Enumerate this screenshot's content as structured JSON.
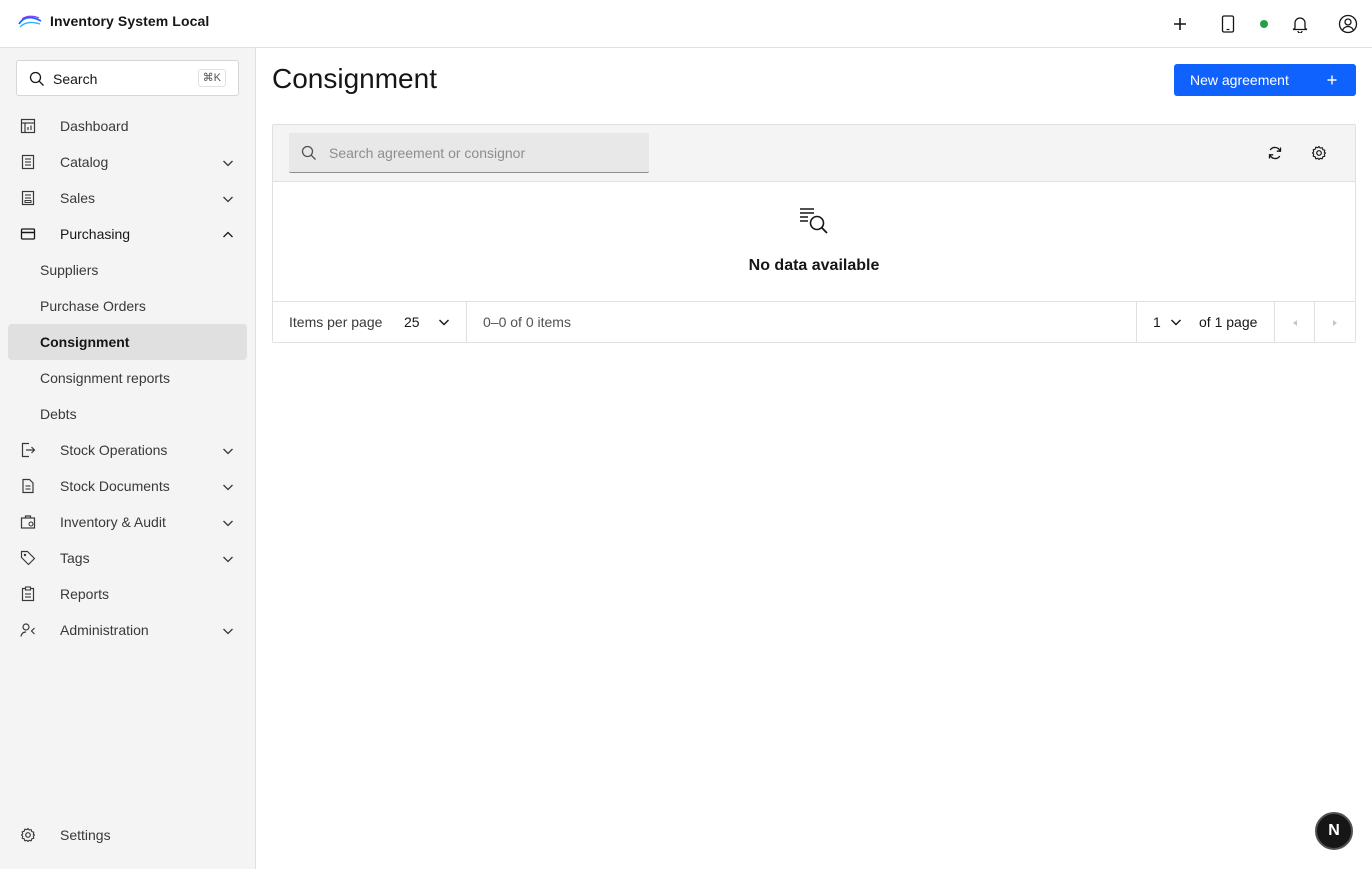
{
  "app": {
    "title": "Inventory System Local"
  },
  "header_icons": [
    "add-icon",
    "tablet-icon",
    "status-dot",
    "notification-icon",
    "user-avatar-icon"
  ],
  "colors": {
    "primary": "#0f62fe",
    "status_online": "#24a148",
    "sidebar_bg": "#f4f4f4",
    "active_item_bg": "#e0e0e0"
  },
  "sidebar": {
    "search_label": "Search",
    "search_shortcut": "⌘K",
    "items": [
      {
        "label": "Dashboard",
        "icon": "dashboard-icon",
        "expandable": false
      },
      {
        "label": "Catalog",
        "icon": "catalog-icon",
        "expandable": true,
        "expanded": false
      },
      {
        "label": "Sales",
        "icon": "sales-icon",
        "expandable": true,
        "expanded": false
      },
      {
        "label": "Purchasing",
        "icon": "purchasing-icon",
        "expandable": true,
        "expanded": true
      }
    ],
    "purchasing_sub": [
      {
        "label": "Suppliers",
        "active": false
      },
      {
        "label": "Purchase Orders",
        "active": false
      },
      {
        "label": "Consignment",
        "active": true
      },
      {
        "label": "Consignment reports",
        "active": false
      },
      {
        "label": "Debts",
        "active": false
      }
    ],
    "items_after": [
      {
        "label": "Stock Operations",
        "icon": "stock-operations-icon",
        "expandable": true
      },
      {
        "label": "Stock Documents",
        "icon": "stock-documents-icon",
        "expandable": true
      },
      {
        "label": "Inventory & Audit",
        "icon": "inventory-audit-icon",
        "expandable": true
      },
      {
        "label": "Tags",
        "icon": "tag-icon",
        "expandable": true
      },
      {
        "label": "Reports",
        "icon": "reports-icon",
        "expandable": false
      },
      {
        "label": "Administration",
        "icon": "administration-icon",
        "expandable": true
      }
    ],
    "settings_label": "Settings"
  },
  "main": {
    "title": "Consignment",
    "primary_button": "New agreement",
    "search_placeholder": "Search agreement or consignor",
    "empty_text": "No data available",
    "pagination": {
      "items_per_page_label": "Items per page",
      "page_size": "25",
      "range": "0–0 of 0 items",
      "current_page": "1",
      "of_pages": "of 1 page"
    }
  },
  "badge": {
    "letter": "N"
  }
}
